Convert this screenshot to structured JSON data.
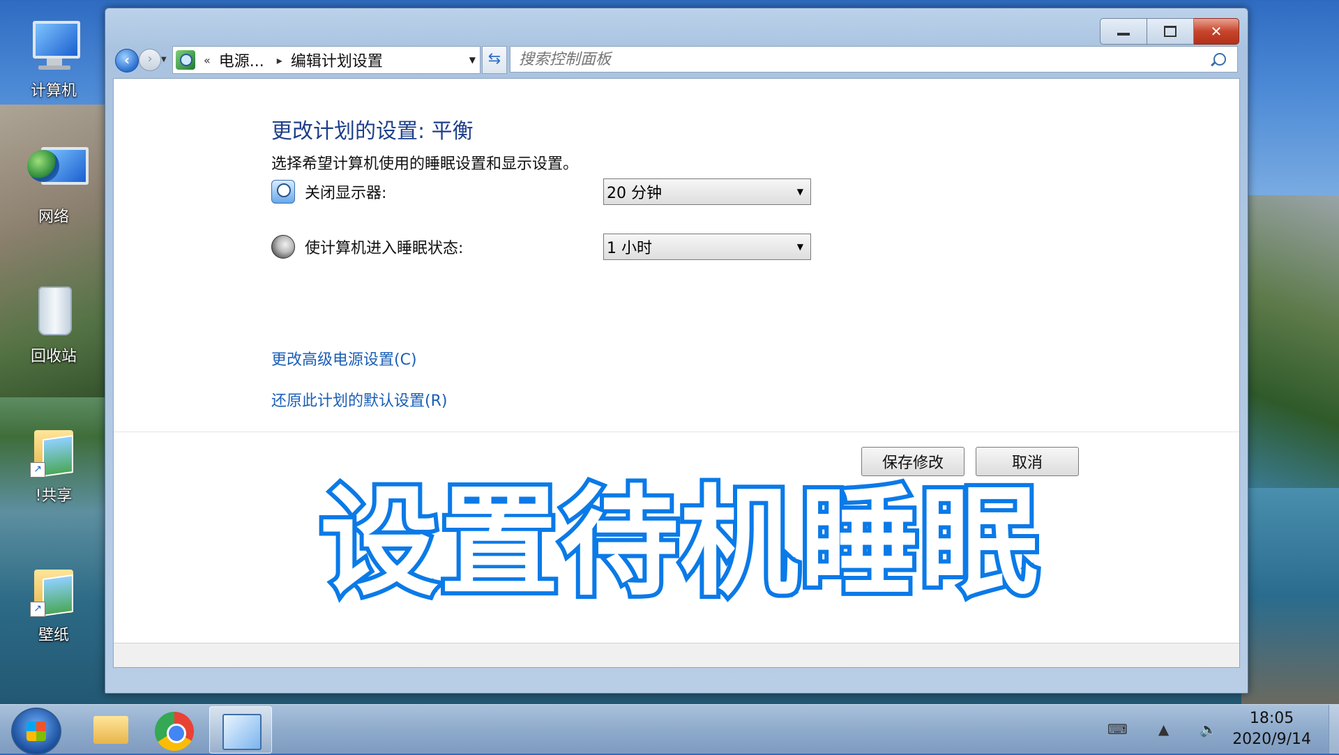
{
  "desktop": {
    "icons": [
      {
        "label": "计算机"
      },
      {
        "label": "网络"
      },
      {
        "label": "回收站"
      },
      {
        "label": "!共享"
      },
      {
        "label": "壁纸"
      }
    ]
  },
  "window": {
    "controls": {
      "minimize": "",
      "maximize": "",
      "close": "✕"
    },
    "address": {
      "back": "‹",
      "forward": "›",
      "overflow": "«",
      "crumbs": [
        "电源...",
        "编辑计划设置"
      ],
      "separator": "▸"
    },
    "search": {
      "placeholder": "搜索控制面板"
    },
    "page": {
      "title": "更改计划的设置: 平衡",
      "subtitle": "选择希望计算机使用的睡眠设置和显示设置。",
      "settings": [
        {
          "label": "关闭显示器:",
          "value": "20 分钟"
        },
        {
          "label": "使计算机进入睡眠状态:",
          "value": "1 小时"
        }
      ],
      "links": [
        "更改高级电源设置(C)",
        "还原此计划的默认设置(R)"
      ],
      "buttons": {
        "save": "保存修改",
        "cancel": "取消"
      }
    }
  },
  "overlay": {
    "caption": "设置待机睡眠"
  },
  "taskbar": {
    "time": "18:05",
    "date": "2020/9/14"
  },
  "colors": {
    "accent": "#1e3f8a",
    "link": "#1b5fb6",
    "overlay_stroke": "#0a7ae8"
  }
}
